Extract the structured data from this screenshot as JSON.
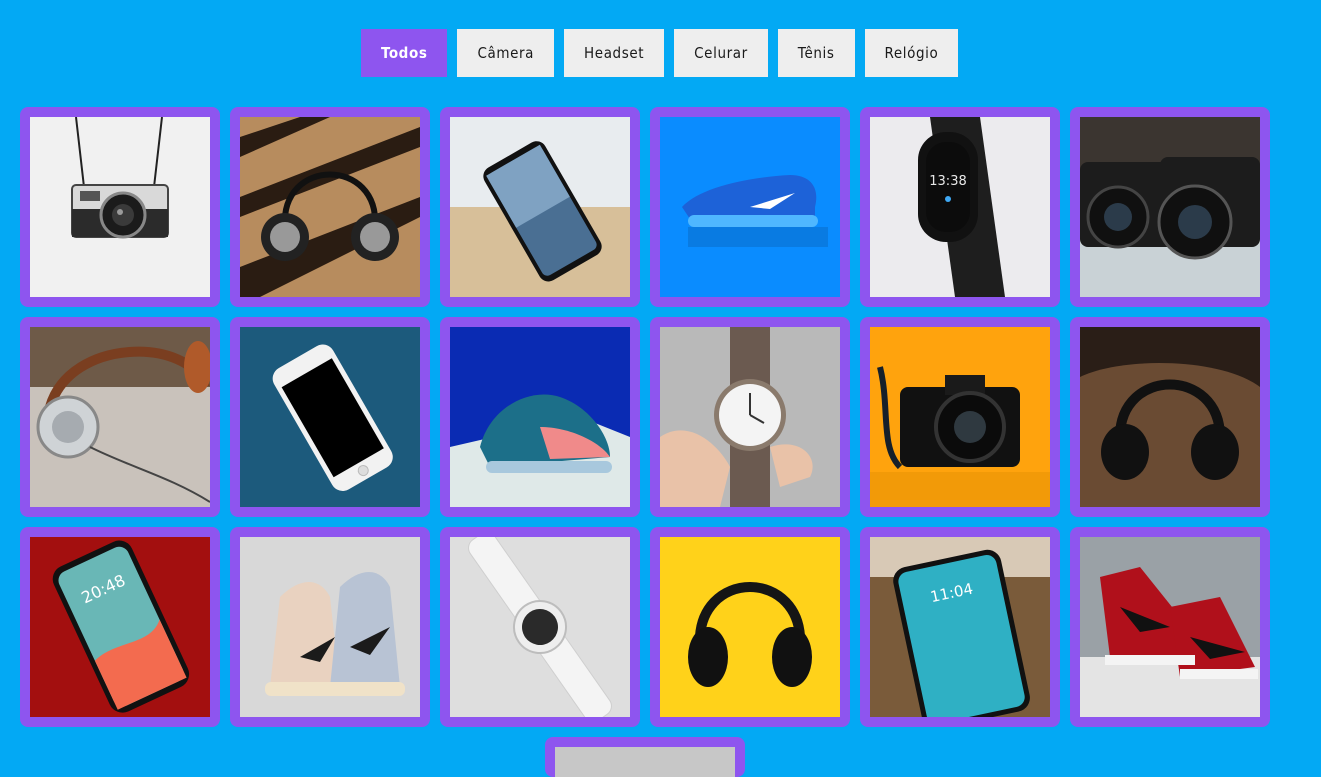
{
  "filters": [
    {
      "label": "Todos",
      "active": true
    },
    {
      "label": "Câmera",
      "active": false
    },
    {
      "label": "Headset",
      "active": false
    },
    {
      "label": "Celurar",
      "active": false
    },
    {
      "label": "Tênis",
      "active": false
    },
    {
      "label": "Relógio",
      "active": false
    }
  ],
  "phone_times": {
    "red_phone": "20:48",
    "iphone_x": "11:04",
    "band_display": "13:38"
  },
  "colors": {
    "page_background": "#03a9f4",
    "accent": "#8e55ef",
    "filter_inactive": "#eeeeee"
  }
}
